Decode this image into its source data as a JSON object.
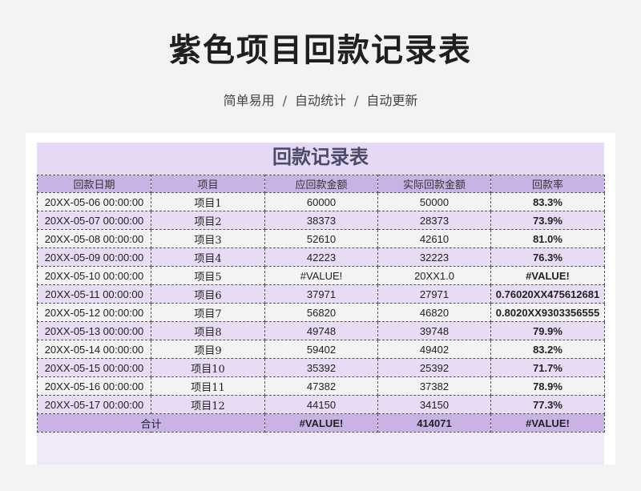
{
  "page": {
    "title": "紫色项目回款记录表",
    "subtitle": [
      "简单易用",
      "自动统计",
      "自动更新"
    ],
    "separator": "/"
  },
  "sheet": {
    "title": "回款记录表",
    "headers": {
      "date": "回款日期",
      "item": "项目",
      "due": "应回款金额",
      "actual": "实际回款金额",
      "rate": "回款率"
    },
    "rows": [
      {
        "date": "20XX-05-06 00:00:00",
        "item": "项目1",
        "due": "60000",
        "actual": "50000",
        "rate": "83.3%"
      },
      {
        "date": "20XX-05-07 00:00:00",
        "item": "项目2",
        "due": "38373",
        "actual": "28373",
        "rate": "73.9%"
      },
      {
        "date": "20XX-05-08 00:00:00",
        "item": "项目3",
        "due": "52610",
        "actual": "42610",
        "rate": "81.0%"
      },
      {
        "date": "20XX-05-09 00:00:00",
        "item": "项目4",
        "due": "42223",
        "actual": "32223",
        "rate": "76.3%"
      },
      {
        "date": "20XX-05-10 00:00:00",
        "item": "项目5",
        "due": "#VALUE!",
        "actual": "20XX1.0",
        "rate": "#VALUE!"
      },
      {
        "date": "20XX-05-11 00:00:00",
        "item": "项目6",
        "due": "37971",
        "actual": "27971",
        "rate": "0.76020XX475612681"
      },
      {
        "date": "20XX-05-12 00:00:00",
        "item": "项目7",
        "due": "56820",
        "actual": "46820",
        "rate": "0.8020XX9303356555"
      },
      {
        "date": "20XX-05-13 00:00:00",
        "item": "项目8",
        "due": "49748",
        "actual": "39748",
        "rate": "79.9%"
      },
      {
        "date": "20XX-05-14 00:00:00",
        "item": "项目9",
        "due": "59402",
        "actual": "49402",
        "rate": "83.2%"
      },
      {
        "date": "20XX-05-15 00:00:00",
        "item": "项目10",
        "due": "35392",
        "actual": "25392",
        "rate": "71.7%"
      },
      {
        "date": "20XX-05-16 00:00:00",
        "item": "项目11",
        "due": "47382",
        "actual": "37382",
        "rate": "78.9%"
      },
      {
        "date": "20XX-05-17 00:00:00",
        "item": "项目12",
        "due": "44150",
        "actual": "34150",
        "rate": "77.3%"
      }
    ],
    "total": {
      "label": "合计",
      "due": "#VALUE!",
      "actual": "414071",
      "rate": "#VALUE!"
    }
  },
  "colors": {
    "header_bg": "#c9b3e5",
    "row_even_bg": "#e7dcf4",
    "row_odd_bg": "#f3f3f3",
    "title_bg": "#e6d9f3"
  }
}
